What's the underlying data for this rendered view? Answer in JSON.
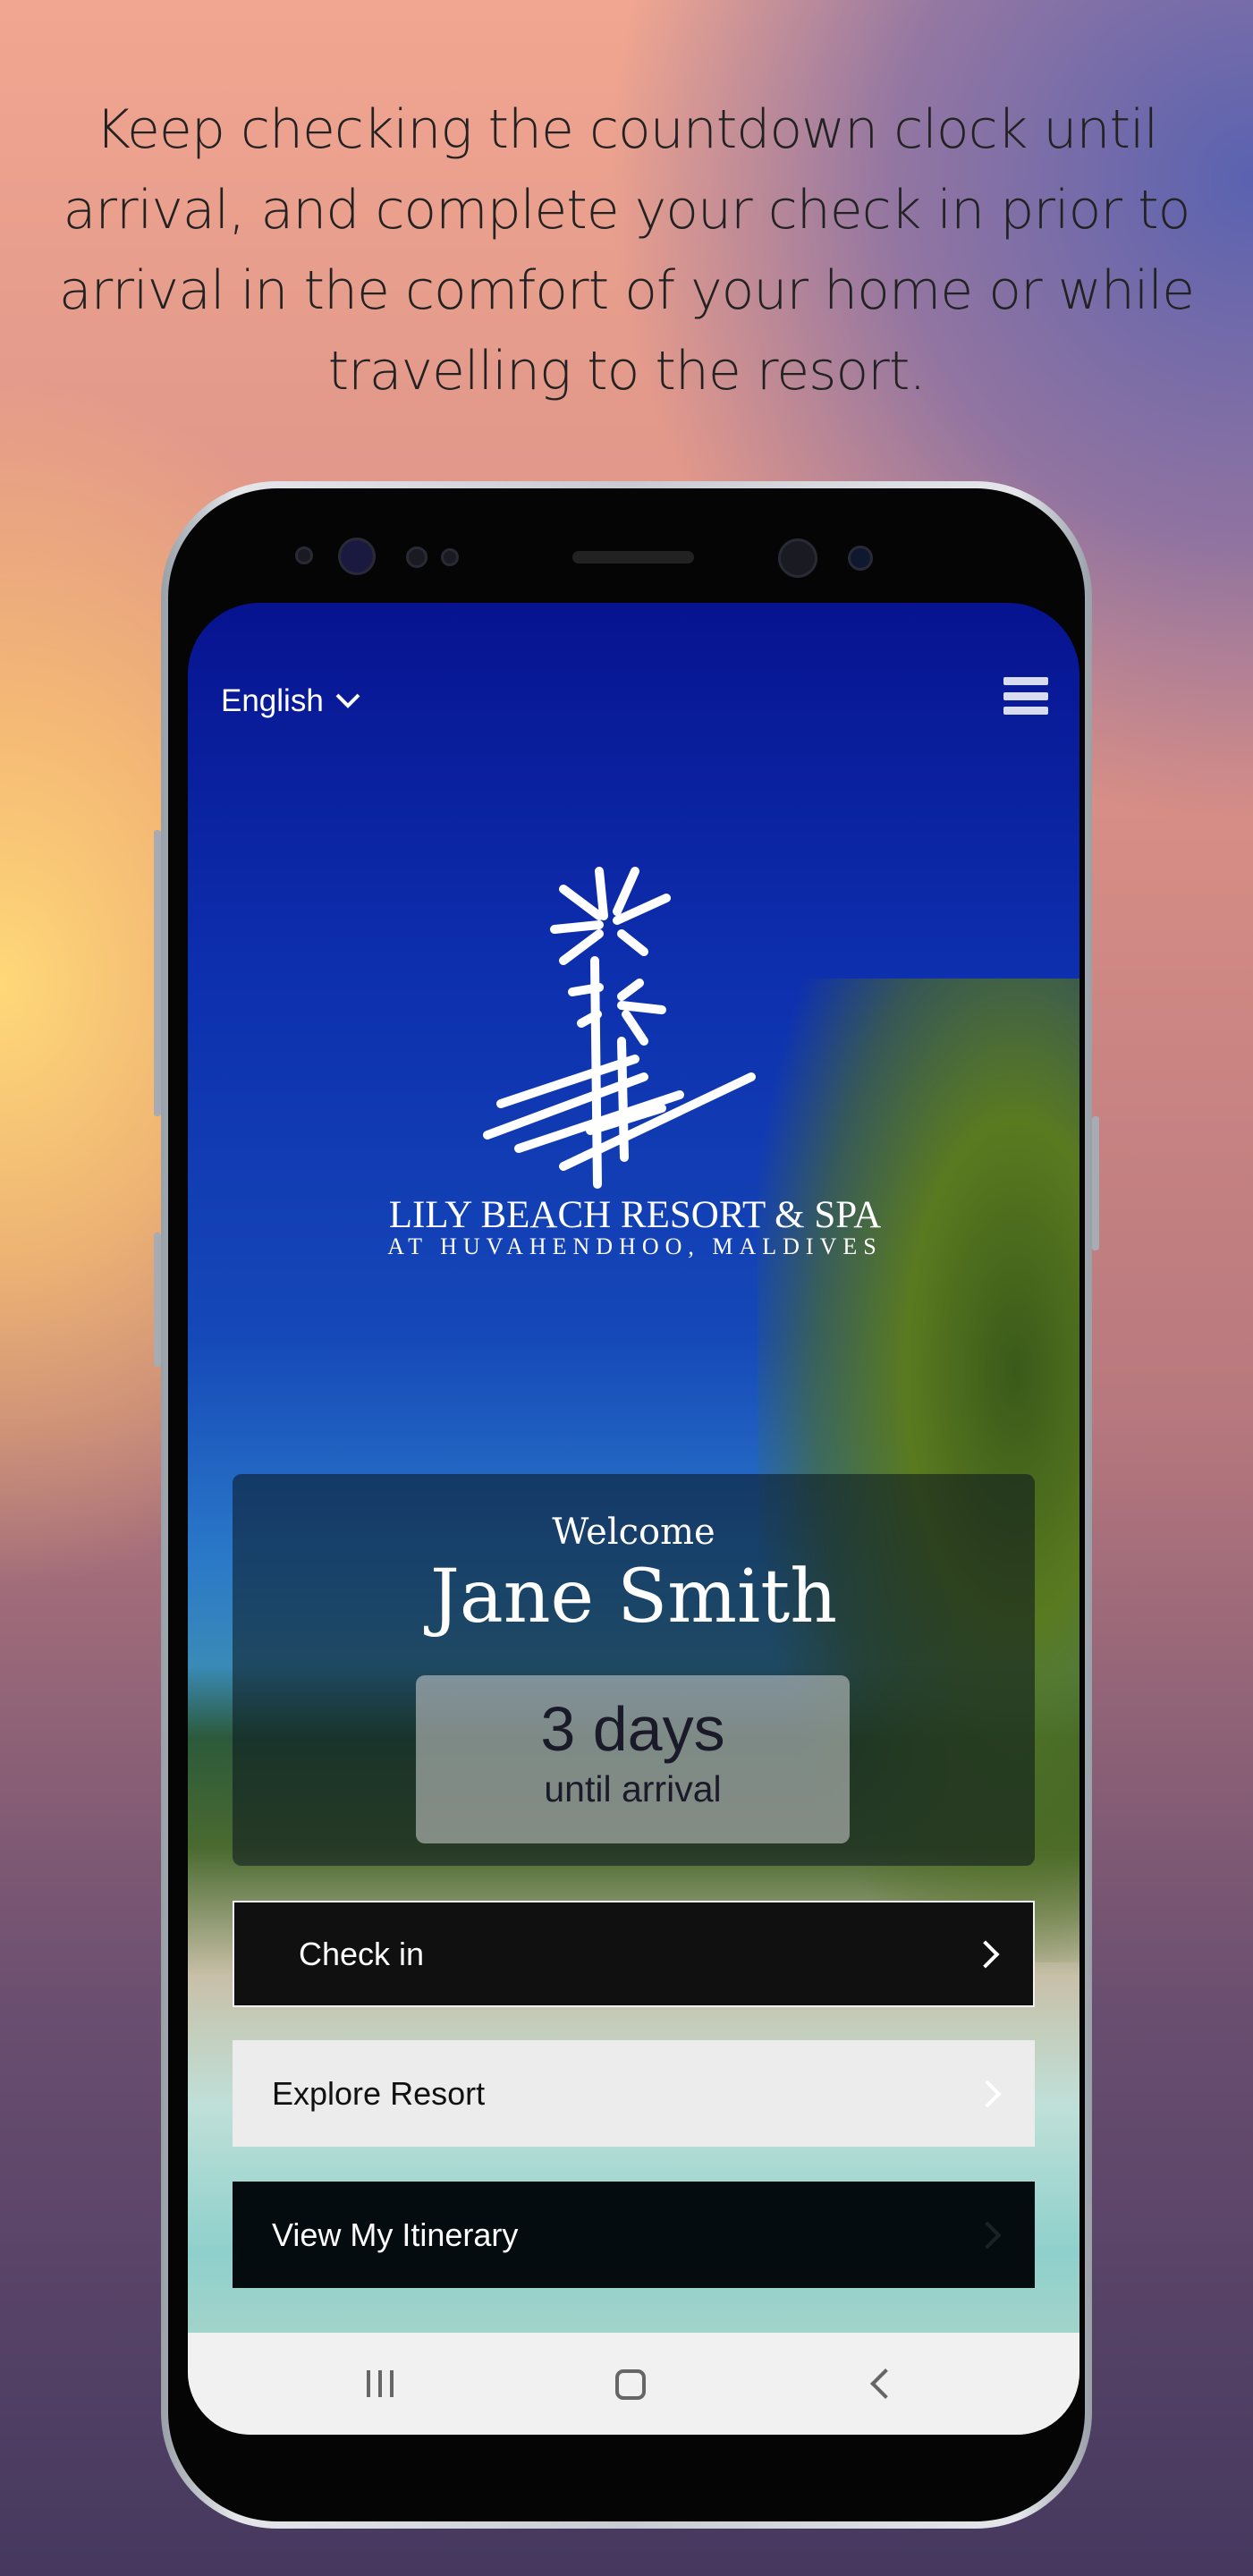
{
  "caption": "Keep checking the countdown clock until arrival, and complete your check in prior to arrival in the comfort of your home or while travelling to the resort.",
  "header": {
    "language": "English",
    "language_icon": "chevron-down-icon",
    "menu_icon": "hamburger-menu-icon"
  },
  "logo": {
    "line1": "LILY BEACH RESORT & SPA",
    "line2": "AT HUVAHENDHOO, MALDIVES"
  },
  "welcome": {
    "greeting": "Welcome",
    "name": "Jane Smith",
    "countdown_value": "3 days",
    "countdown_label": "until arrival"
  },
  "actions": [
    {
      "label": "Check in",
      "icon": "chevron-right-icon"
    },
    {
      "label": "Explore Resort",
      "icon": "chevron-right-icon"
    },
    {
      "label": "View My Itinerary",
      "icon": "chevron-right-icon"
    }
  ],
  "navbar": {
    "recent_icon": "recent-apps-icon",
    "home_icon": "home-icon",
    "back_icon": "back-icon"
  },
  "colors": {
    "sky": "#0d2fae",
    "button_dark": "#101010",
    "button_light": "#ececec"
  }
}
